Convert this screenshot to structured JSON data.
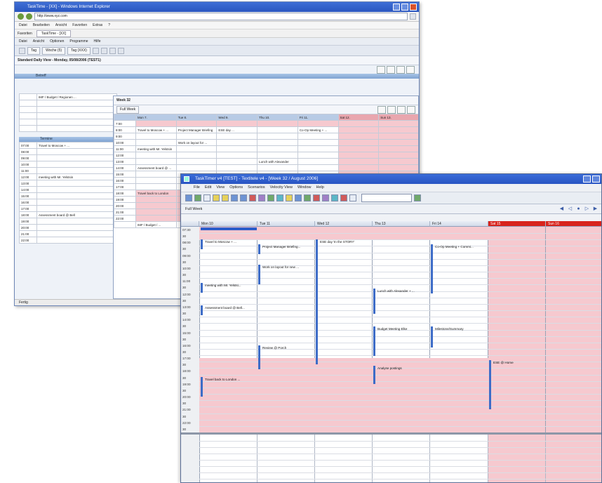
{
  "back_window": {
    "title": "TaskTime - [XX] - Windows Internet Explorer",
    "address": "http://www.xyz.com",
    "menu": [
      "Datei",
      "Bearbeiten",
      "Ansicht",
      "Favoriten",
      "Extras",
      "?"
    ],
    "tab_label": "TaskTime - [XX]",
    "favorites_label": "Favoriten",
    "app_menu": [
      "Datei",
      "Ansicht",
      "Optionen",
      "Programme",
      "Hilfe"
    ],
    "toolbar_buttons": [
      "Tag",
      "Woche (5)",
      "Tag (XXX)"
    ],
    "daily_title": "Standard Daily View - Monday, 05/08/2006 (TEST1)",
    "left_header": "Betreff",
    "left_rows": [
      "IMF / Budget / Regionen ..."
    ],
    "left_header2": "Termine",
    "left_times": [
      "07:00",
      "08:00",
      "09:00",
      "10:00",
      "11:00",
      "12:00",
      "13:00",
      "14:00",
      "15:00",
      "16:00",
      "17:00",
      "18:00",
      "19:00",
      "20:00",
      "21:00",
      "22:00"
    ],
    "left_events": [
      "Travel to Moscow + ...",
      "meeting with Mr. Yelstsin",
      "Assessment board @ Bell"
    ],
    "week_title": "Week 32",
    "week_dropdown": "Full Week",
    "week_days": [
      "Mon 7.",
      "Tue 8.",
      "Wed 9.",
      "Thu 10.",
      "Fri 11.",
      "Sat 12.",
      "Sun 13."
    ],
    "week_times": [
      "7:00",
      "8:00",
      "9:00",
      "10:00",
      "11:00",
      "12:00",
      "13:00",
      "14:00",
      "15:00",
      "16:00",
      "17:00",
      "18:00",
      "19:00",
      "20:00",
      "21:00",
      "22:00"
    ],
    "week_events": [
      "Travel to Moscow + ...",
      "Project Manager Briefing",
      "ESE day ...",
      "Co-Op Meeting + ...",
      "Work on layout for ...",
      "meeting with Mr. Yelstsin",
      "Lunch with Alexander",
      "Assessment board @ ...",
      "Travel back to London"
    ],
    "week_note": "IMF / Budget / ...",
    "status": "Fertig"
  },
  "front_window": {
    "title": "TaskTimer v4 [TEST] - Textitele v4 - [Week 32 / August 2006]",
    "menu": [
      "File",
      "Edit",
      "View",
      "Options",
      "Scenarios",
      "Velocity View",
      "Window",
      "Help"
    ],
    "view_label": "Full Week",
    "days": [
      "Mon 10",
      "Tue 11",
      "Wed 12",
      "Thu 13",
      "Fri 14",
      "Sat 15",
      "Sun 16"
    ],
    "times": [
      "07:30",
      "30",
      "08:00",
      "30",
      "09:00",
      "30",
      "10:00",
      "30",
      "11:00",
      "30",
      "12:00",
      "30",
      "13:00",
      "30",
      "14:00",
      "30",
      "15:00",
      "30",
      "16:00",
      "30",
      "17:00",
      "30",
      "18:00",
      "30",
      "19:00",
      "30",
      "20:00",
      "30",
      "21:00",
      "30",
      "22:00",
      "30"
    ],
    "events": {
      "mon_1": "Travel to Moscow + ...",
      "mon_2": "meeting with Mr. Yelstsi...",
      "mon_3": "Assessment board @ Bell...",
      "mon_4": "Travel back to London ...",
      "tue_1": "Project Manager Briefing...",
      "tue_2": "Work on layout for new ...",
      "tue_3": "Review @ Porch",
      "wed_1": "ESE day 'In the STORY'",
      "thu_1": "Lunch with Alexander + ...",
      "thu_2": "Budget Meeting Elke",
      "thu_3": "Analyse postings",
      "fri_1": "Co-Op Meeting + Commi...",
      "fri_2": "Milestone/Summary",
      "sat_1": "ESE @ Home"
    },
    "colors": {
      "accent": "#3d6cc7",
      "weekend": "#d8231c",
      "offhours": "#f6c9cf"
    }
  }
}
